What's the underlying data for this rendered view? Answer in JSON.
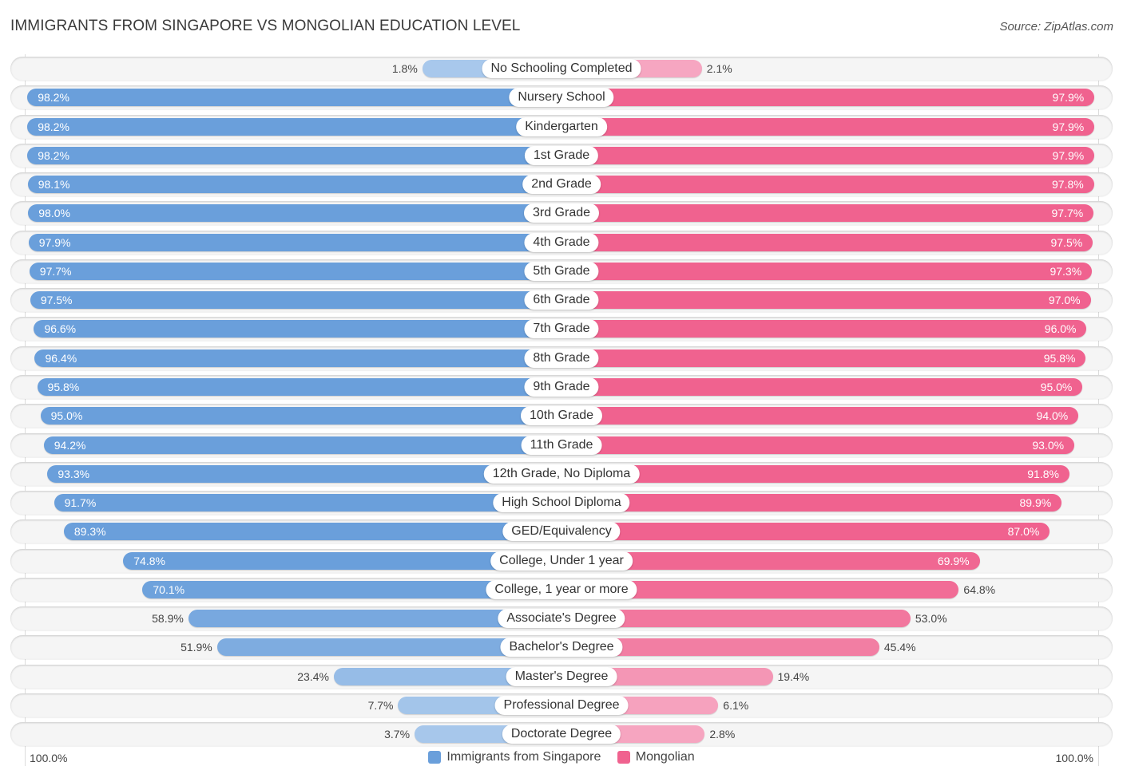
{
  "header": {
    "title": "IMMIGRANTS FROM SINGAPORE VS MONGOLIAN EDUCATION LEVEL",
    "source": "Source: ZipAtlas.com"
  },
  "colors": {
    "left_strong": "#6a9fdb",
    "left_light": "#aac9ec",
    "right_strong": "#f0628f",
    "right_light": "#f6a8c2"
  },
  "axis": {
    "left_label": "100.0%",
    "right_label": "100.0%"
  },
  "legend": [
    {
      "label": "Immigrants from Singapore",
      "color": "#6a9fdb"
    },
    {
      "label": "Mongolian",
      "color": "#f0628f"
    }
  ],
  "chart_data": {
    "type": "bar",
    "orientation": "horizontal-diverging",
    "title": "IMMIGRANTS FROM SINGAPORE VS MONGOLIAN EDUCATION LEVEL",
    "xlabel": "",
    "ylabel": "",
    "xlim": [
      0,
      100
    ],
    "unit": "%",
    "legend_position": "bottom-center",
    "categories": [
      "No Schooling Completed",
      "Nursery School",
      "Kindergarten",
      "1st Grade",
      "2nd Grade",
      "3rd Grade",
      "4th Grade",
      "5th Grade",
      "6th Grade",
      "7th Grade",
      "8th Grade",
      "9th Grade",
      "10th Grade",
      "11th Grade",
      "12th Grade, No Diploma",
      "High School Diploma",
      "GED/Equivalency",
      "College, Under 1 year",
      "College, 1 year or more",
      "Associate's Degree",
      "Bachelor's Degree",
      "Master's Degree",
      "Professional Degree",
      "Doctorate Degree"
    ],
    "series": [
      {
        "name": "Immigrants from Singapore",
        "side": "left",
        "values": [
          1.8,
          98.2,
          98.2,
          98.2,
          98.1,
          98.0,
          97.9,
          97.7,
          97.5,
          96.6,
          96.4,
          95.8,
          95.0,
          94.2,
          93.3,
          91.7,
          89.3,
          74.8,
          70.1,
          58.9,
          51.9,
          23.4,
          7.7,
          3.7
        ],
        "labels": [
          "1.8%",
          "98.2%",
          "98.2%",
          "98.2%",
          "98.1%",
          "98.0%",
          "97.9%",
          "97.7%",
          "97.5%",
          "96.6%",
          "96.4%",
          "95.8%",
          "95.0%",
          "94.2%",
          "93.3%",
          "91.7%",
          "89.3%",
          "74.8%",
          "70.1%",
          "58.9%",
          "51.9%",
          "23.4%",
          "7.7%",
          "3.7%"
        ]
      },
      {
        "name": "Mongolian",
        "side": "right",
        "values": [
          2.1,
          97.9,
          97.9,
          97.9,
          97.8,
          97.7,
          97.5,
          97.3,
          97.0,
          96.0,
          95.8,
          95.0,
          94.0,
          93.0,
          91.8,
          89.9,
          87.0,
          69.9,
          64.8,
          53.0,
          45.4,
          19.4,
          6.1,
          2.8
        ],
        "labels": [
          "2.1%",
          "97.9%",
          "97.9%",
          "97.9%",
          "97.8%",
          "97.7%",
          "97.5%",
          "97.3%",
          "97.0%",
          "96.0%",
          "95.8%",
          "95.0%",
          "94.0%",
          "93.0%",
          "91.8%",
          "89.9%",
          "87.0%",
          "69.9%",
          "64.8%",
          "53.0%",
          "45.4%",
          "19.4%",
          "6.1%",
          "2.8%"
        ]
      }
    ]
  }
}
